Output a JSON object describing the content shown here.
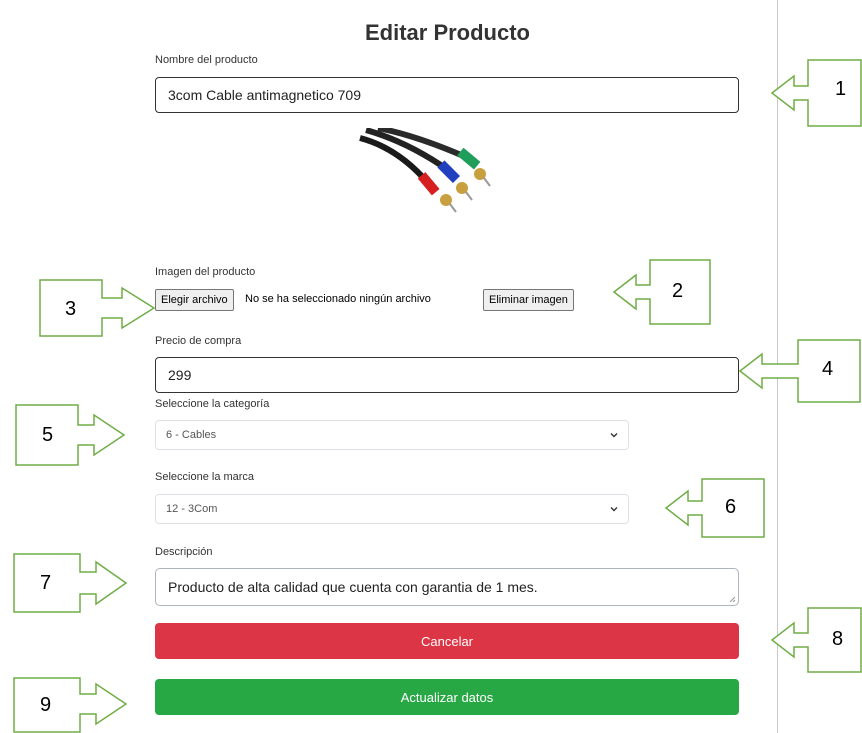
{
  "form": {
    "title": "Editar Producto",
    "name_label": "Nombre del producto",
    "name_value": "3com Cable antimagnetico 709",
    "image_label": "Imagen del producto",
    "choose_file": "Elegir archivo",
    "no_file": "No se ha seleccionado ningún archivo",
    "remove_image": "Eliminar imagen",
    "price_label": "Precio de compra",
    "price_value": "299",
    "category_label": "Seleccione la categoría",
    "category_value": "6 - Cables",
    "brand_label": "Seleccione la marca",
    "brand_value": "12 - 3Com",
    "description_label": "Descripción",
    "description_value": "Producto de alta calidad que cuenta con garantia de 1 mes.",
    "cancel": "Cancelar",
    "update": "Actualizar datos"
  },
  "callouts": [
    "1",
    "2",
    "3",
    "4",
    "5",
    "6",
    "7",
    "8",
    "9"
  ],
  "colors": {
    "danger": "#dc3545",
    "success": "#28a745",
    "callout_green": "#70ad47"
  },
  "icons": [
    "rca-cable-image",
    "chevron-down-icon",
    "resize-grip-icon",
    "arrow-callout"
  ]
}
